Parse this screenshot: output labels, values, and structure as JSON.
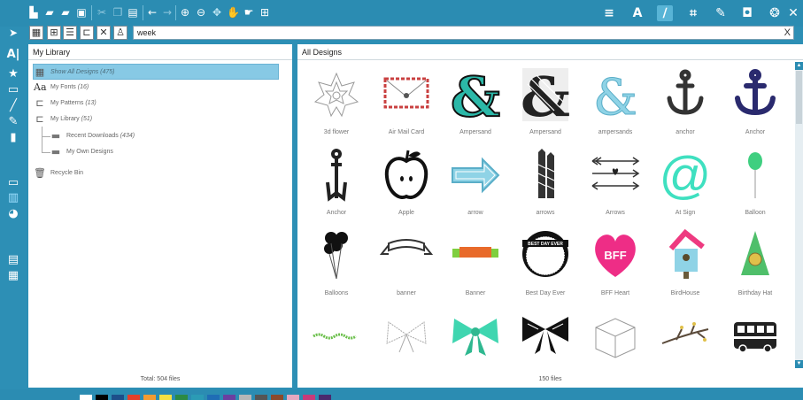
{
  "toolbar": {
    "file_icons": [
      "new-file-icon",
      "open-folder-icon",
      "open-folder-recent-icon",
      "print-icon",
      "cut-icon",
      "copy-icon",
      "paste-icon",
      "undo-icon",
      "redo-icon",
      "zoom-in-icon",
      "zoom-out-icon",
      "zoom-select-icon",
      "pan-icon",
      "hand-icon",
      "fit-page-icon"
    ],
    "right_icons": [
      "list-lines-icon",
      "text-tool-icon",
      "pen-tool-icon",
      "crop-icon",
      "knife-icon",
      "shape-icon",
      "palette-icon"
    ]
  },
  "library_toolbar": {
    "view_icons": [
      "thumbnail-view-icon",
      "grid-view-icon",
      "list-view-icon",
      "folder-icon",
      "delete-x-icon",
      "user-icon"
    ],
    "search_value": "week",
    "clear_glyph": "X"
  },
  "library": {
    "title": "My Library",
    "items": [
      {
        "label": "Show All Designs",
        "count": "(475)"
      },
      {
        "label": "My Fonts",
        "count": "(16)"
      },
      {
        "label": "My Patterns",
        "count": "(13)"
      },
      {
        "label": "My Library",
        "count": "(51)"
      },
      {
        "label": "Recent Downloads",
        "count": "(434)"
      },
      {
        "label": "My Own Designs",
        "count": ""
      },
      {
        "label": "Recycle Bin",
        "count": ""
      }
    ],
    "total": "Total: 504 files"
  },
  "designs": {
    "title": "All Designs",
    "tiles": [
      {
        "label": "3d flower"
      },
      {
        "label": "Air Mail Card"
      },
      {
        "label": "Ampersand"
      },
      {
        "label": "Ampersand"
      },
      {
        "label": "ampersands"
      },
      {
        "label": "anchor"
      },
      {
        "label": "Anchor"
      },
      {
        "label": "Anchor"
      },
      {
        "label": "Apple"
      },
      {
        "label": "arrow"
      },
      {
        "label": "arrows"
      },
      {
        "label": "Arrows"
      },
      {
        "label": "At Sign"
      },
      {
        "label": "Balloon"
      },
      {
        "label": "Balloons"
      },
      {
        "label": "banner"
      },
      {
        "label": "Banner"
      },
      {
        "label": "Best Day Ever"
      },
      {
        "label": "BFF Heart"
      },
      {
        "label": "BirdHouse"
      },
      {
        "label": "Birthday Hat"
      },
      {
        "label": ""
      },
      {
        "label": ""
      },
      {
        "label": ""
      },
      {
        "label": ""
      },
      {
        "label": ""
      },
      {
        "label": ""
      },
      {
        "label": ""
      }
    ],
    "count": "150 files",
    "tile_texts": {
      "best_day": "BEST DAY EVER",
      "bff": "BFF"
    }
  },
  "colors": {
    "chrome": "#2b8cb2",
    "selected": "#87c9e5",
    "teal": "#3fd6c0",
    "pink": "#ee2d86",
    "light_blue": "#8fd3e6",
    "navy": "#2a2a6e"
  },
  "swatches": [
    "#ffffff",
    "#000000",
    "#1d4e8a",
    "#e53f2b",
    "#f29b31",
    "#f5e142",
    "#2c8a45",
    "#2b9bb5",
    "#1f6db5",
    "#6b3fa0",
    "#b7b7b7",
    "#555555",
    "#8b4a2b",
    "#e6a8c0",
    "#c73a7a",
    "#4a2a6e"
  ]
}
